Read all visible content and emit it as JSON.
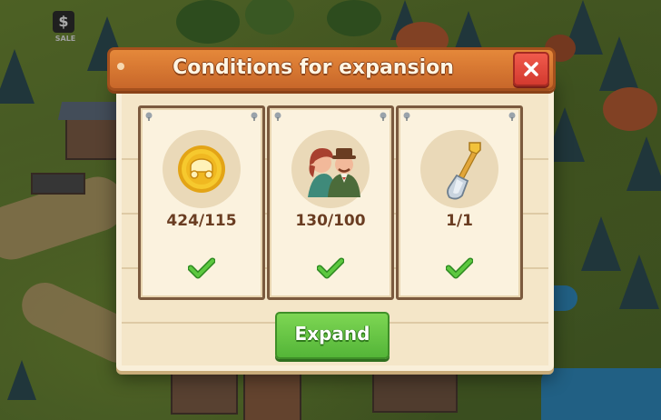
{
  "scene": {
    "sale_sign_symbol": "$",
    "sale_sign_label": "SALE"
  },
  "dialog": {
    "title": "Conditions for expansion",
    "close_icon": "close-x-icon",
    "requirements": [
      {
        "icon": "coin-icon",
        "value": "424/115",
        "met": true
      },
      {
        "icon": "villagers-icon",
        "value": "130/100",
        "met": true
      },
      {
        "icon": "shovel-icon",
        "value": "1/1",
        "met": true
      }
    ],
    "expand_label": "Expand"
  },
  "colors": {
    "banner": "#d9782f",
    "close_button": "#e1463a",
    "expand_button": "#63c043",
    "check": "#3aa82c",
    "count_text": "#6a3d22",
    "card_border": "#7b5a3e"
  }
}
